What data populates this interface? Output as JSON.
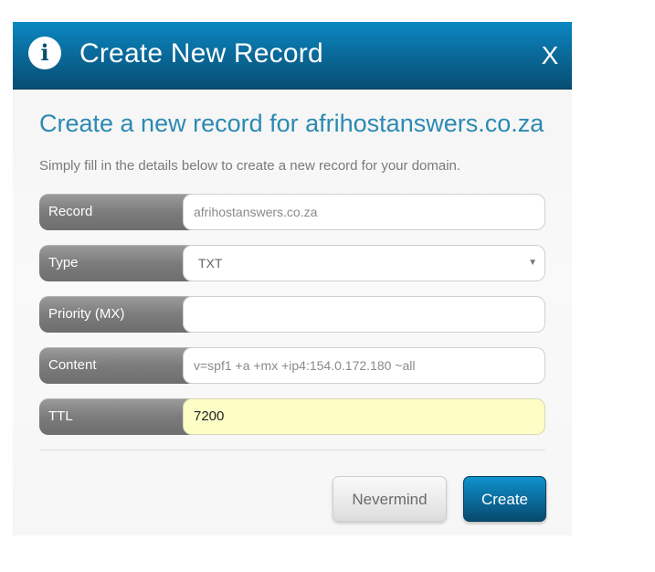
{
  "dialog": {
    "title": "Create New Record",
    "close_label": "X",
    "info_icon": "info-icon",
    "info_glyph": "i",
    "header_color": "#0a6c9d"
  },
  "heading": "Create a new record for afrihostanswers.co.za",
  "subtext": "Simply fill in the details below to create a new record for your domain.",
  "form": {
    "record": {
      "label": "Record",
      "value": "afrihostanswers.co.za"
    },
    "type": {
      "label": "Type",
      "value": "TXT",
      "caret": "▼"
    },
    "priority": {
      "label": "Priority (MX)",
      "value": ""
    },
    "content": {
      "label": "Content",
      "value": "v=spf1 +a +mx +ip4:154.0.172.180 ~all"
    },
    "ttl": {
      "label": "TTL",
      "value": "7200"
    }
  },
  "buttons": {
    "nevermind": "Nevermind",
    "create": "Create"
  },
  "colors": {
    "accent": "#2b8ab3",
    "ttl_highlight": "#fdfdc6"
  }
}
